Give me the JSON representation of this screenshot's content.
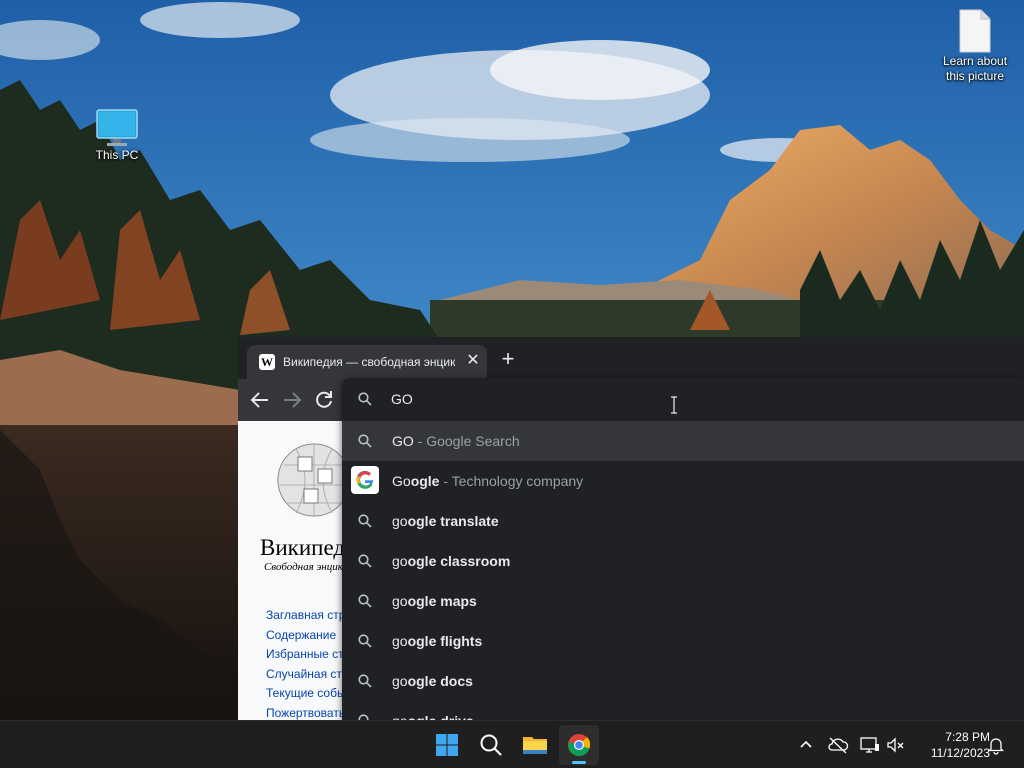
{
  "desktop": {
    "icons": [
      {
        "label": "This PC"
      },
      {
        "label": "Learn about this picture"
      }
    ]
  },
  "browser": {
    "tab": {
      "title": "Википедия — свободная энциклопедия",
      "favicon": "W"
    },
    "toolbar": {
      "back": "back-arrow-icon",
      "forward": "forward-arrow-icon",
      "reload": "reload-icon"
    },
    "omnibox": {
      "input_value": "GO",
      "suggestions": [
        {
          "typed": "GO",
          "bold": "",
          "desc": "- Google Search",
          "icon": "search-icon",
          "selected": true
        },
        {
          "typed": "Go",
          "bold": "ogle",
          "desc": "- Technology company",
          "icon": "google-logo",
          "selected": false
        },
        {
          "typed": "go",
          "bold": "ogle translate",
          "desc": "",
          "icon": "search-icon",
          "selected": false
        },
        {
          "typed": "go",
          "bold": "ogle classroom",
          "desc": "",
          "icon": "search-icon",
          "selected": false
        },
        {
          "typed": "go",
          "bold": "ogle maps",
          "desc": "",
          "icon": "search-icon",
          "selected": false
        },
        {
          "typed": "go",
          "bold": "ogle flights",
          "desc": "",
          "icon": "search-icon",
          "selected": false
        },
        {
          "typed": "go",
          "bold": "ogle docs",
          "desc": "",
          "icon": "search-icon",
          "selected": false
        },
        {
          "typed": "go",
          "bold": "ogle drive",
          "desc": "",
          "icon": "search-icon",
          "selected": false
        }
      ]
    },
    "page": {
      "logo_word": "Википедия",
      "tagline": "Свободная энциклопедия",
      "nav": [
        "Заглавная страница",
        "Содержание",
        "Избранные статьи",
        "Случайная статья",
        "Текущие события",
        "Пожертвовать"
      ]
    }
  },
  "taskbar": {
    "time": "7:28 PM",
    "date": "11/12/2023",
    "apps": [
      "start-icon",
      "search-icon",
      "file-explorer-icon",
      "chrome-icon"
    ]
  },
  "colors": {
    "chrome_bg": "#202124",
    "chrome_toolbar": "#35363a",
    "accent": "#8ab4f8",
    "taskbar_bg": "#1f1f1f",
    "active_indicator": "#4cc2ff"
  }
}
